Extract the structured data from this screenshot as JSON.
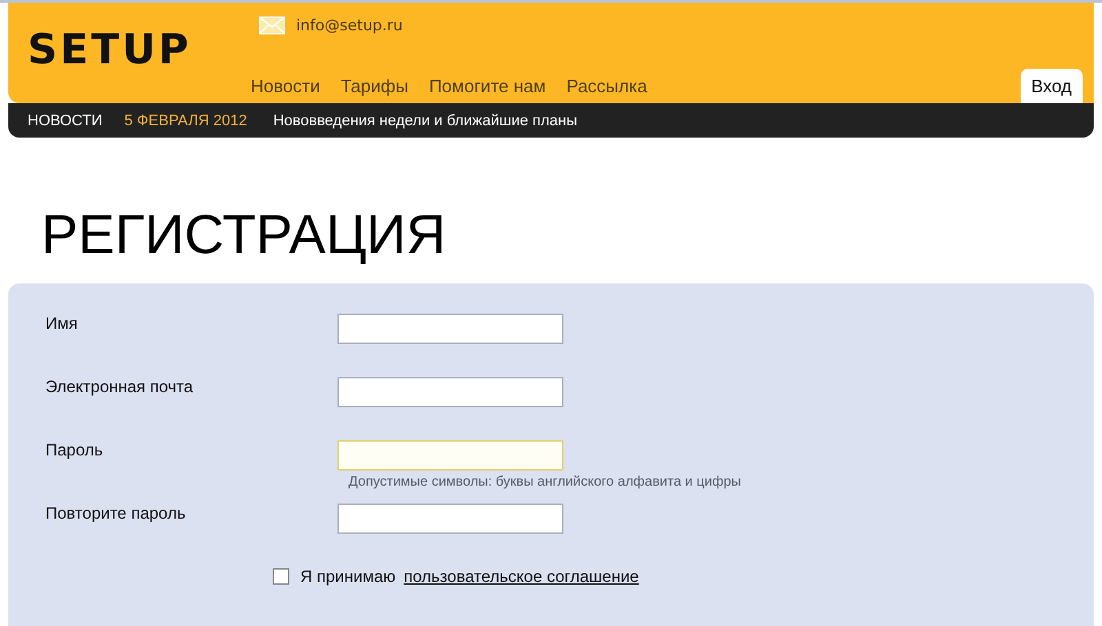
{
  "header": {
    "logo": "SETUP",
    "email": "info@setup.ru",
    "nav": [
      {
        "label": "Новости"
      },
      {
        "label": "Тарифы"
      },
      {
        "label": "Помогите нам"
      },
      {
        "label": "Рассылка"
      }
    ],
    "login_button": "Вход"
  },
  "news_bar": {
    "label": "НОВОСТИ",
    "date": "5 ФЕВРАЛЯ 2012",
    "headline": "Нововведения недели и ближайшие планы"
  },
  "title": "РЕГИСТРАЦИЯ",
  "form": {
    "fields": [
      {
        "label": "Имя",
        "focused": false
      },
      {
        "label": "Электронная почта",
        "focused": false
      },
      {
        "label": "Пароль",
        "focused": true,
        "hint": "Допустимые символы: буквы английского алфавита и цифры"
      },
      {
        "label": "Повторите пароль",
        "focused": false
      }
    ],
    "agreement": {
      "checked": false,
      "text": "Я принимаю",
      "link": "пользовательское соглашение"
    }
  }
}
